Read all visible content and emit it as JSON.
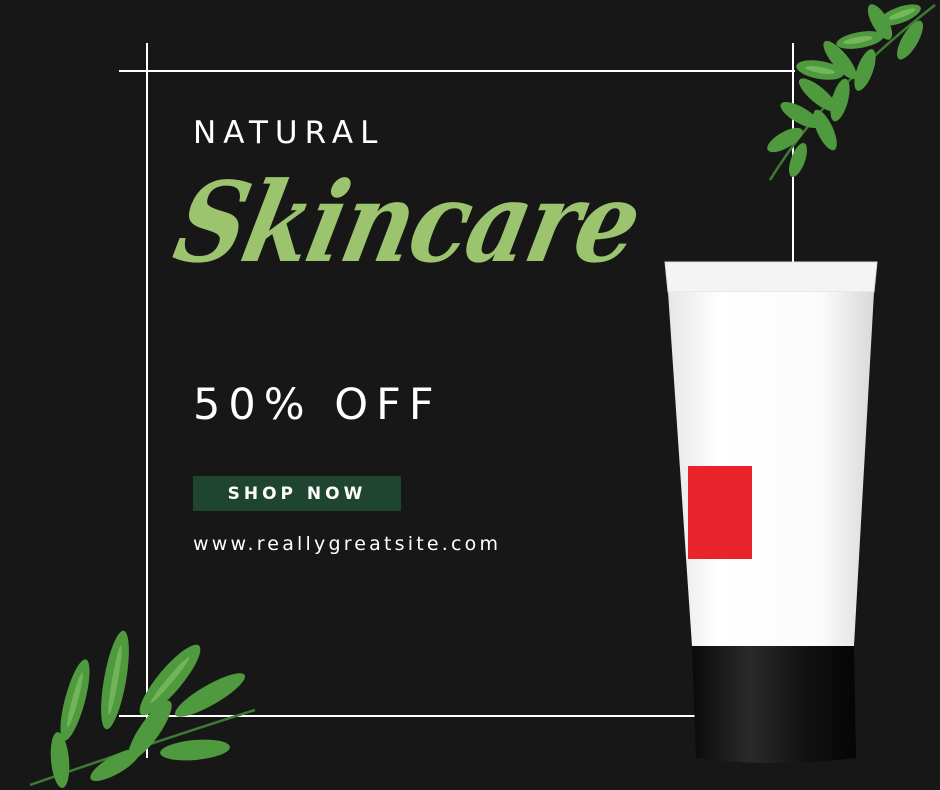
{
  "headline_top": "NATURAL",
  "headline_script": "Skincare",
  "discount": "50% OFF",
  "cta_label": "SHOP NOW",
  "website": "www.reallygreatsite.com",
  "colors": {
    "background": "#171717",
    "script_green": "#9cc46f",
    "button_green": "#1f4530",
    "tube_label_red": "#e8232c",
    "leaf_green": "#4f9a3e"
  },
  "icons": [
    "leaf-branch-top-right",
    "leaf-branch-bottom-left",
    "skincare-tube"
  ]
}
